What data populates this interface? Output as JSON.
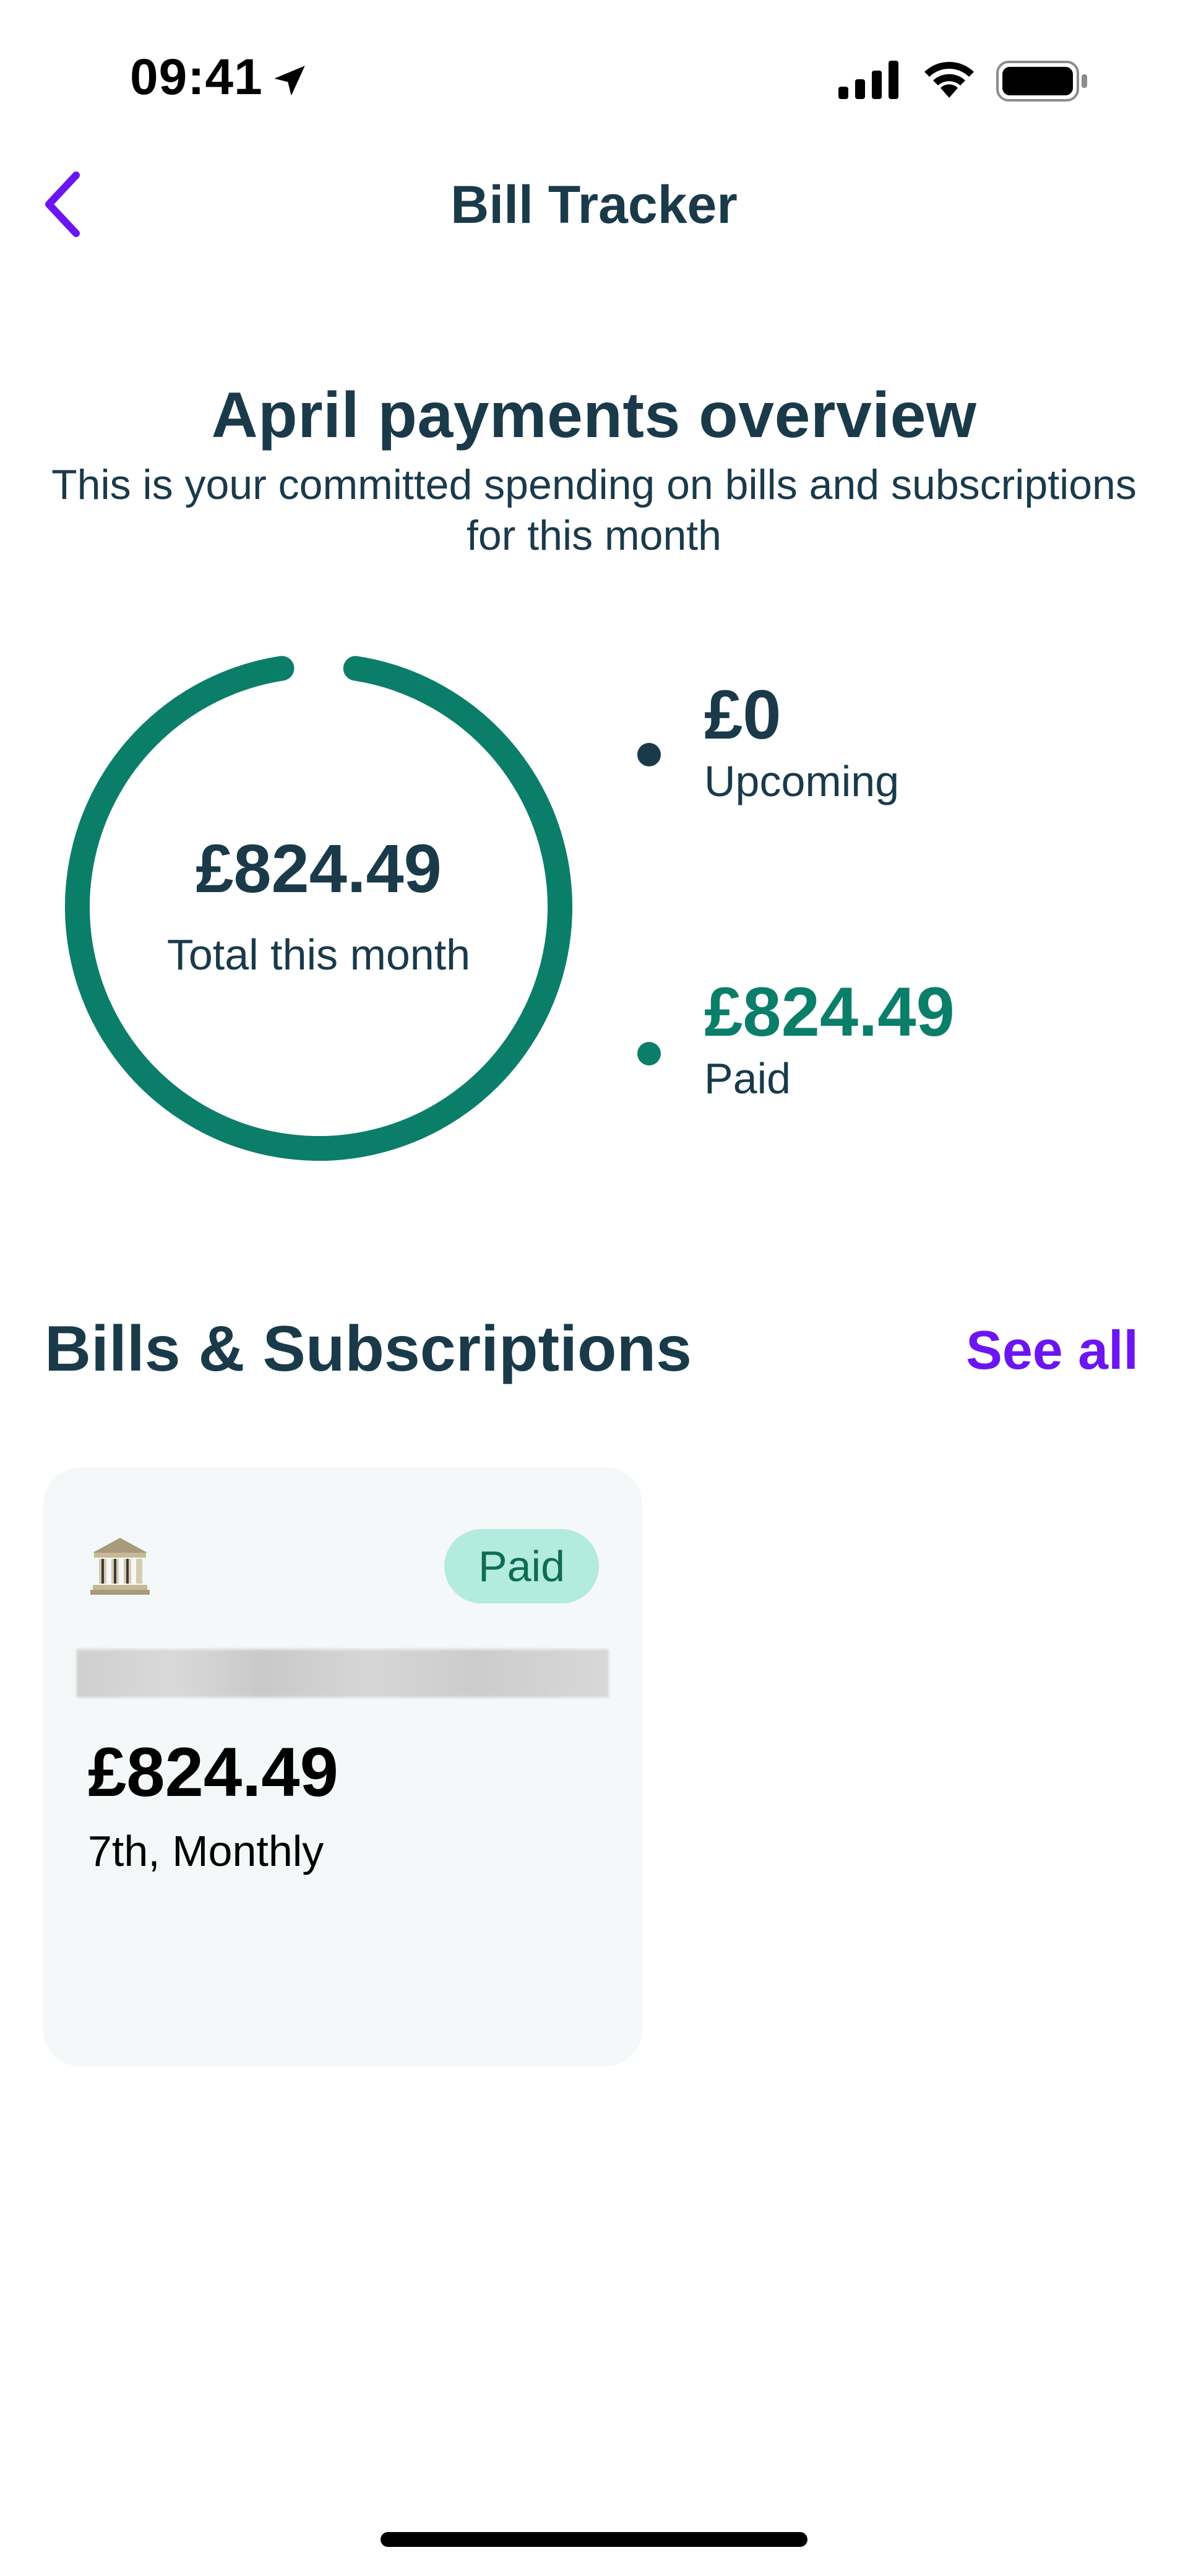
{
  "status_bar": {
    "time": "09:41",
    "icons": [
      "location-arrow-icon",
      "signal-icon",
      "wifi-icon",
      "battery-icon"
    ]
  },
  "nav": {
    "back_icon": "chevron-left-icon",
    "title": "Bill Tracker"
  },
  "overview": {
    "title": "April payments overview",
    "subtitle_line1": "This is your committed spending on bills and subscriptions",
    "subtitle_line2": "for this month"
  },
  "donut": {
    "total": "£824.49",
    "caption": "Total this month",
    "paid_fraction": 1.0,
    "color_paid": "#0b7e69",
    "color_upcoming": "#1a3a4a"
  },
  "legend": {
    "upcoming": {
      "value": "£0",
      "label": "Upcoming",
      "color": "#1a3a4a"
    },
    "paid": {
      "value": "£824.49",
      "label": "Paid",
      "color": "#0b7e69"
    }
  },
  "bills_section": {
    "title": "Bills & Subscriptions",
    "see_all": "See all",
    "accent_color": "#6b16f0"
  },
  "bills": [
    {
      "icon": "bank-building-icon",
      "status": "Paid",
      "amount": "£824.49",
      "schedule": "7th, Monthly"
    }
  ]
}
